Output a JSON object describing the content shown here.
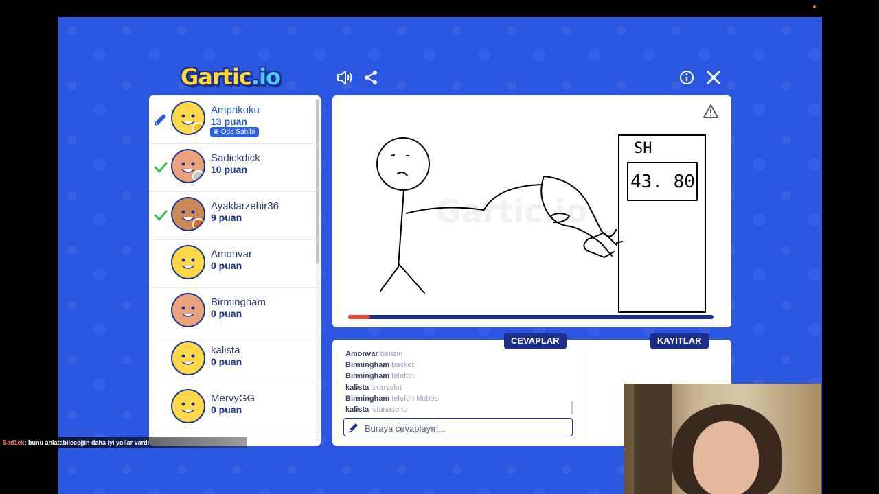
{
  "app": {
    "logo_main": "Gartic",
    "logo_suffix": ".io"
  },
  "players": [
    {
      "name": "Amprikuku",
      "score": "13 puan",
      "status": "drawing",
      "badge_color": "#f3c623",
      "owner_label": "Oda Sahibi",
      "skin": "#ffd84a",
      "active": true
    },
    {
      "name": "Sadickdick",
      "score": "10 puan",
      "status": "guessed",
      "badge_color": "#c8c8c8",
      "skin": "#e9a27b",
      "active": false
    },
    {
      "name": "Ayaklarzehir36",
      "score": "9 puan",
      "status": "guessed",
      "badge_color": "#d9662a",
      "skin": "#c98a5a",
      "active": false
    },
    {
      "name": "Amonvar",
      "score": "0 puan",
      "status": "none",
      "skin": "#ffd84a",
      "active": false
    },
    {
      "name": "Birmingham",
      "score": "0 puan",
      "status": "none",
      "skin": "#e9a27b",
      "active": false
    },
    {
      "name": "kalista",
      "score": "0 puan",
      "status": "none",
      "skin": "#ffd84a",
      "active": false
    },
    {
      "name": "MervyGG",
      "score": "0 puan",
      "status": "none",
      "skin": "#ffd84a",
      "active": false
    }
  ],
  "round": {
    "time_progress": 0.06
  },
  "chat": {
    "tabs": {
      "answers": "CEVAPLAR",
      "logs": "KAYITLAR"
    },
    "messages": [
      {
        "user": "Amonvar",
        "text": "benzin"
      },
      {
        "user": "Birmingham",
        "text": "basket"
      },
      {
        "user": "Birmingham",
        "text": "telefon"
      },
      {
        "user": "kalista",
        "text": "akaryakıt"
      },
      {
        "user": "Birmingham",
        "text": "telefon klubesi"
      },
      {
        "user": "kalista",
        "text": "istanasonu"
      }
    ],
    "input_placeholder": "Buraya cevaplayın..."
  },
  "drawing": {
    "sign_text": "SH",
    "price_text": "43. 80"
  },
  "stream_overlay": {
    "user": "Sad1ck",
    "message": ": bunu anlatabileceğin daha iyi yollar vardı"
  },
  "colors": {
    "background": "#2b56e0",
    "navy": "#1c2f8c",
    "accent": "#2557d6",
    "timer": "#e04b3c"
  }
}
